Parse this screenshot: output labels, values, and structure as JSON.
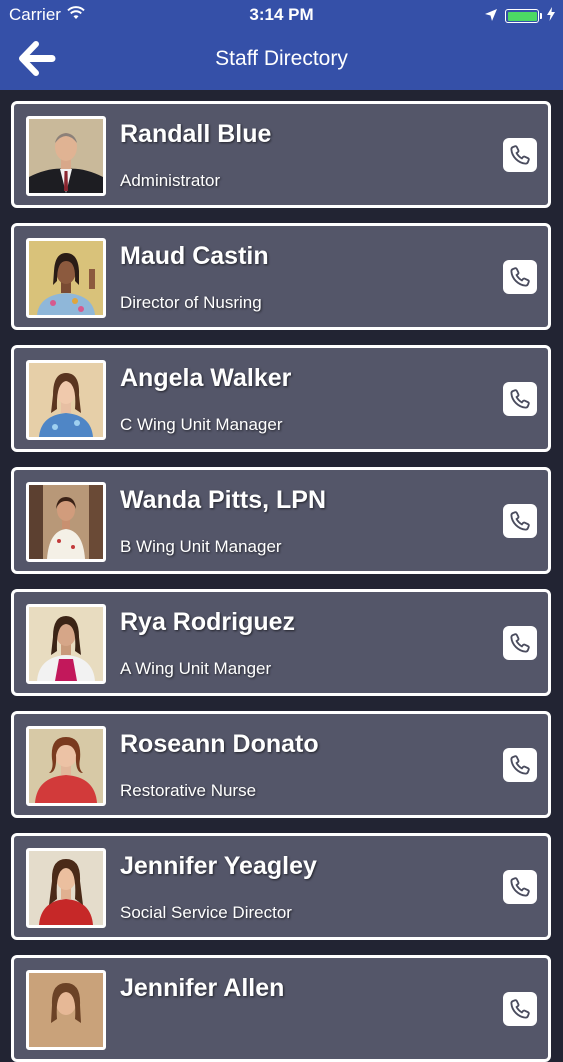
{
  "status_bar": {
    "carrier": "Carrier",
    "time": "3:14 PM",
    "icons": [
      "wifi-icon",
      "location-arrow-icon",
      "battery-icon",
      "charging-bolt-icon"
    ]
  },
  "nav": {
    "title": "Staff Directory",
    "back_icon": "back-arrow-icon"
  },
  "colors": {
    "nav_background": "#3550a8",
    "card_background": "#545669",
    "page_background": "#222433",
    "battery_fill": "#4cd964"
  },
  "staff": [
    {
      "name": "Randall Blue",
      "role": "Administrator"
    },
    {
      "name": "Maud Castin",
      "role": "Director of Nusring"
    },
    {
      "name": "Angela Walker",
      "role": "C Wing Unit Manager"
    },
    {
      "name": "Wanda Pitts, LPN",
      "role": "B Wing Unit Manager"
    },
    {
      "name": "Rya Rodriguez",
      "role": "A Wing Unit Manger"
    },
    {
      "name": "Roseann Donato",
      "role": "Restorative Nurse"
    },
    {
      "name": "Jennifer Yeagley",
      "role": "Social Service Director"
    },
    {
      "name": "Jennifer  Allen",
      "role": ""
    }
  ]
}
